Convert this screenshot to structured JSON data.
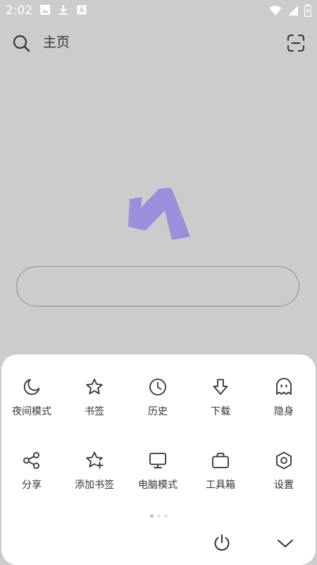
{
  "status_bar": {
    "time": "2:02",
    "left_icons": [
      "image-icon",
      "download-icon",
      "a-icon"
    ],
    "right_icons": [
      "wifi-icon",
      "signal-icon",
      "battery-icon"
    ]
  },
  "top_bar": {
    "title": "主页",
    "left_icon": "search-icon",
    "right_icon": "scan-icon"
  },
  "logo": {
    "color": "#9b8edb"
  },
  "search": {
    "value": "",
    "placeholder": ""
  },
  "menu": {
    "rows": [
      [
        {
          "label": "夜间模式",
          "icon": "moon-icon"
        },
        {
          "label": "书签",
          "icon": "star-icon"
        },
        {
          "label": "历史",
          "icon": "clock-icon"
        },
        {
          "label": "下载",
          "icon": "arrow-down-icon"
        },
        {
          "label": "隐身",
          "icon": "ghost-icon"
        }
      ],
      [
        {
          "label": "分享",
          "icon": "share-icon"
        },
        {
          "label": "添加书签",
          "icon": "star-plus-icon"
        },
        {
          "label": "电脑模式",
          "icon": "monitor-icon"
        },
        {
          "label": "工具箱",
          "icon": "toolbox-icon"
        },
        {
          "label": "设置",
          "icon": "hexagon-settings-icon"
        }
      ]
    ],
    "page_dots": 3,
    "active_page": 0
  },
  "bottom_actions": {
    "power_icon": "power-icon",
    "collapse_icon": "chevron-down-icon"
  }
}
